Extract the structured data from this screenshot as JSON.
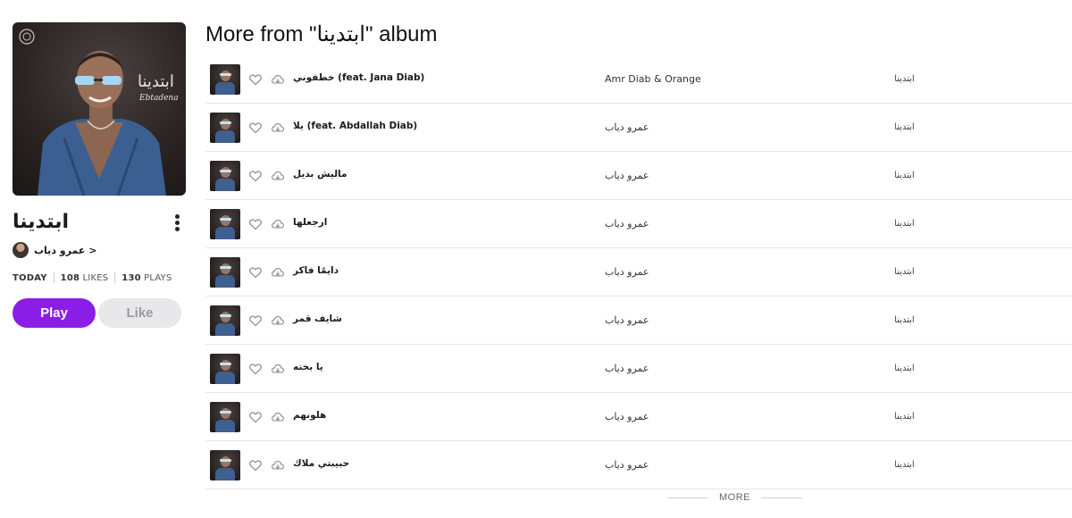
{
  "album": {
    "title": "ابتدينا",
    "artist": "‫< عمرو دياب‬",
    "stats": {
      "date": "TODAY",
      "likes_count": "108",
      "likes_label": "LIKES",
      "plays_count": "130",
      "plays_label": "PLAYS"
    },
    "cover_text": "ابتدينا",
    "cover_subtext": "Ebtadena"
  },
  "actions": {
    "play_label": "Play",
    "like_label": "Like"
  },
  "section": {
    "title": "More from \"ابتدينا\" album"
  },
  "tracks": [
    {
      "name": "خطفوني (feat. Jana Diab)",
      "artist": "Amr Diab & Orange",
      "album": "ابتدينا"
    },
    {
      "name": "يلا (feat. Abdallah Diab)",
      "artist": "عمرو دياب",
      "album": "ابتدينا"
    },
    {
      "name": "ماليش بديل",
      "artist": "عمرو دياب",
      "album": "ابتدينا"
    },
    {
      "name": "ارجعلها",
      "artist": "عمرو دياب",
      "album": "ابتدينا"
    },
    {
      "name": "دايمًا فاكر",
      "artist": "عمرو دياب",
      "album": "ابتدينا"
    },
    {
      "name": "شايف قمر",
      "artist": "عمرو دياب",
      "album": "ابتدينا"
    },
    {
      "name": "يا بخته",
      "artist": "عمرو دياب",
      "album": "ابتدينا"
    },
    {
      "name": "هلونهم",
      "artist": "عمرو دياب",
      "album": "ابتدينا"
    },
    {
      "name": "حبيبتي ملاك",
      "artist": "عمرو دياب",
      "album": "ابتدينا"
    }
  ],
  "more_label": "MORE",
  "colors": {
    "accent": "#8a1ee6",
    "like_bg": "#e8e8ea"
  }
}
